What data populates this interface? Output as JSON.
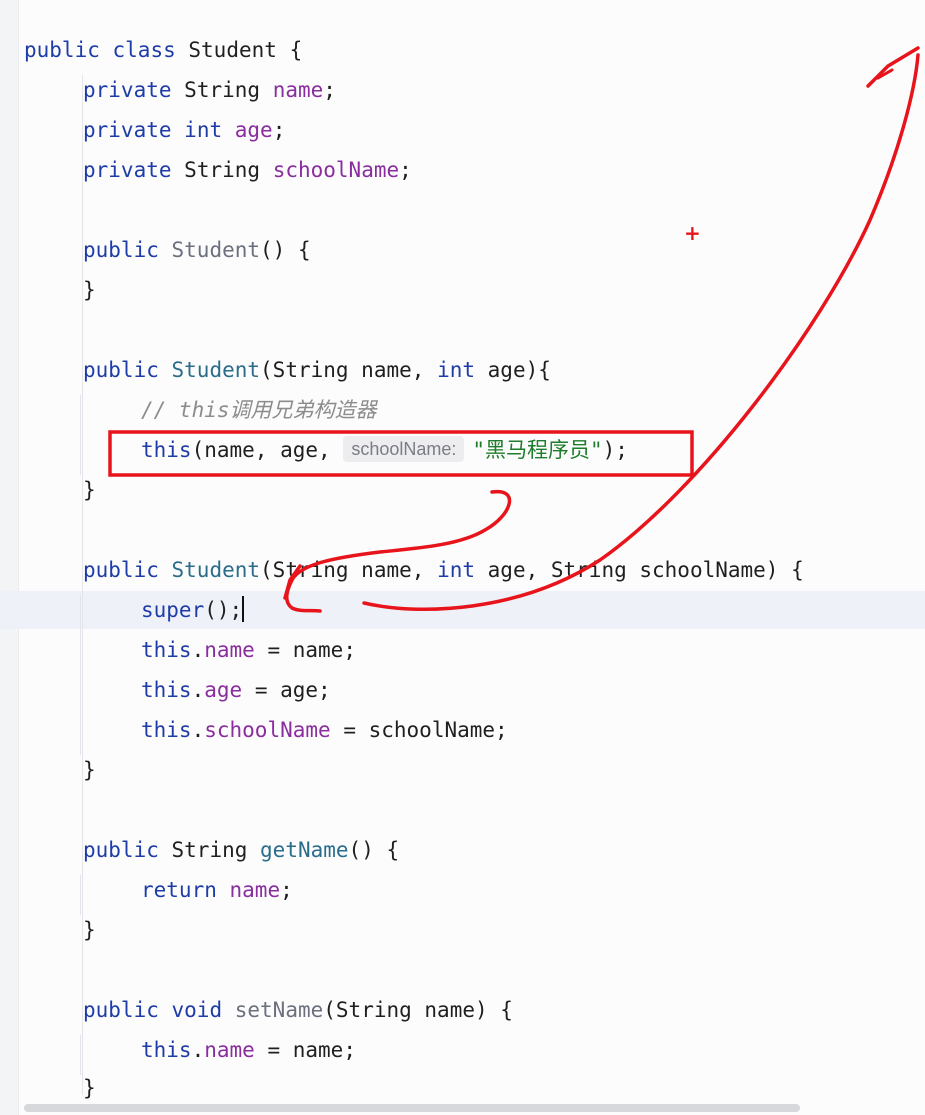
{
  "editor": {
    "lines": [
      {
        "k": "public",
        "k2": "class",
        "t": "Student",
        "p": "{"
      },
      {
        "k": "private",
        "type": "String",
        "f": "name",
        "p": ";"
      },
      {
        "k": "private",
        "k2": "int",
        "f": "age",
        "p": ";"
      },
      {
        "k": "private",
        "type": "String",
        "f": "schoolName",
        "p": ";"
      },
      {
        "k": "public",
        "m": "Student",
        "p": "() {"
      },
      {
        "p": "}"
      },
      {
        "k": "public",
        "m": "Student",
        "p1": "(String name,",
        "k2": "int",
        "p2": "age){"
      },
      {
        "c": "// this调用兄弟构造器"
      },
      {
        "k": "this",
        "p1": "(name, age,",
        "hint": "schoolName:",
        "s": "\"黑马程序员\"",
        "p2": ");"
      },
      {
        "p": "}"
      },
      {
        "k": "public",
        "m": "Student",
        "p1": "(String name,",
        "k2": "int",
        "p2": "age, String schoolName) {"
      },
      {
        "k": "super",
        "p": "();"
      },
      {
        "k": "this",
        "dot": ".",
        "f": "name",
        "p": " = name;"
      },
      {
        "k": "this",
        "dot": ".",
        "f": "age",
        "p": " = age;"
      },
      {
        "k": "this",
        "dot": ".",
        "f": "schoolName",
        "p": " = schoolName;"
      },
      {
        "p": "}"
      },
      {
        "k": "public",
        "type": "String",
        "m": "getName",
        "p": "() {"
      },
      {
        "k": "return",
        "f": "name",
        "p": ";"
      },
      {
        "p": "}"
      },
      {
        "k": "public",
        "k2": "void",
        "m": "setName",
        "p": "(String name) {"
      },
      {
        "k": "this",
        "dot": ".",
        "f": "name",
        "p": " = name;"
      },
      {
        "p": "}"
      }
    ]
  },
  "annotation": {
    "color": "#e8141c",
    "plus_mark": "+"
  }
}
